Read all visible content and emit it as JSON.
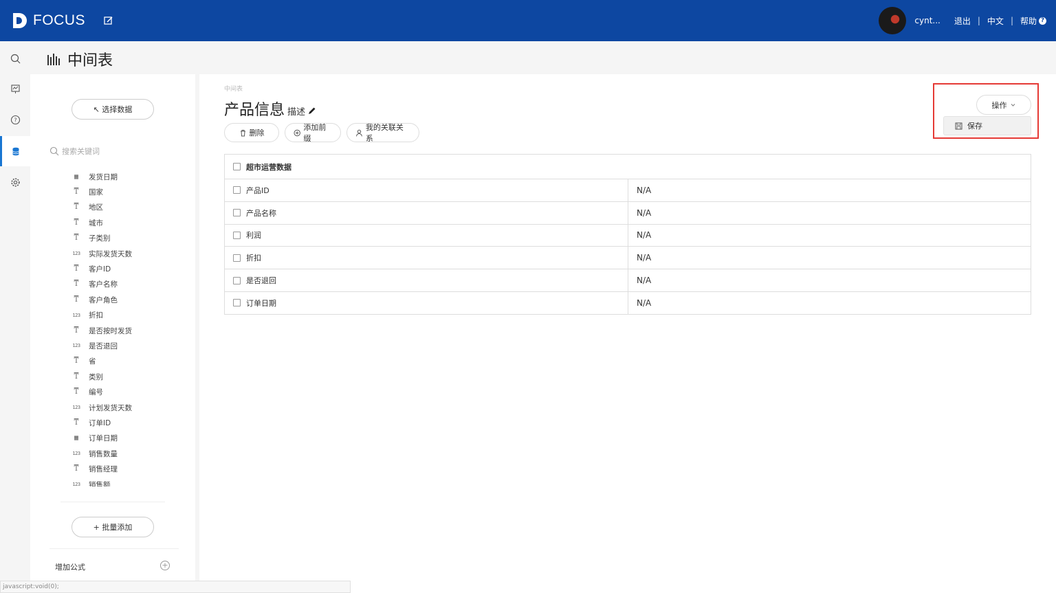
{
  "topbar": {
    "brand": "FOCUS",
    "user_name": "cynt...",
    "logout_label": "退出",
    "language_label": "中文",
    "help_label": "帮助",
    "brand_color": "#0d47a1"
  },
  "page": {
    "title": "中间表"
  },
  "side": {
    "select_data_label": "↖ 选择数据",
    "search_placeholder": "搜索关键词",
    "fields": [
      {
        "name": "发货日期",
        "type": "date"
      },
      {
        "name": "国家",
        "type": "text"
      },
      {
        "name": "地区",
        "type": "text"
      },
      {
        "name": "城市",
        "type": "text"
      },
      {
        "name": "子类别",
        "type": "text"
      },
      {
        "name": "实际发货天数",
        "type": "number"
      },
      {
        "name": "客户ID",
        "type": "text"
      },
      {
        "name": "客户名称",
        "type": "text"
      },
      {
        "name": "客户角色",
        "type": "text"
      },
      {
        "name": "折扣",
        "type": "number"
      },
      {
        "name": "是否按时发货",
        "type": "text"
      },
      {
        "name": "是否退回",
        "type": "number"
      },
      {
        "name": "省",
        "type": "text"
      },
      {
        "name": "类别",
        "type": "text"
      },
      {
        "name": "编号",
        "type": "text"
      },
      {
        "name": "计划发货天数",
        "type": "number"
      },
      {
        "name": "订单ID",
        "type": "text"
      },
      {
        "name": "订单日期",
        "type": "date"
      },
      {
        "name": "销售数量",
        "type": "number"
      },
      {
        "name": "销售经理",
        "type": "text"
      },
      {
        "name": "销售额",
        "type": "number"
      }
    ],
    "batch_add_label": "+ 批量添加",
    "add_formula_label": "增加公式"
  },
  "main": {
    "breadcrumb": "中间表",
    "title": "产品信息",
    "desc_label": "描述",
    "delete_label": "删除",
    "add_prefix_label": "添加前缀",
    "my_relations_label": "我的关联关系",
    "operate_label": "操作",
    "save_label": "保存",
    "table": {
      "header": "超市运营数据",
      "rows": [
        {
          "name": "产品ID",
          "value": "N/A"
        },
        {
          "name": "产品名称",
          "value": "N/A"
        },
        {
          "name": "利润",
          "value": "N/A"
        },
        {
          "name": "折扣",
          "value": "N/A"
        },
        {
          "name": "是否退回",
          "value": "N/A"
        },
        {
          "name": "订单日期",
          "value": "N/A"
        }
      ]
    }
  },
  "statusbar": {
    "text": "javascript:void(0);"
  },
  "icons": {
    "text_type": "text-type-icon",
    "number_type": "number-type-icon",
    "date_type": "calendar-icon"
  }
}
